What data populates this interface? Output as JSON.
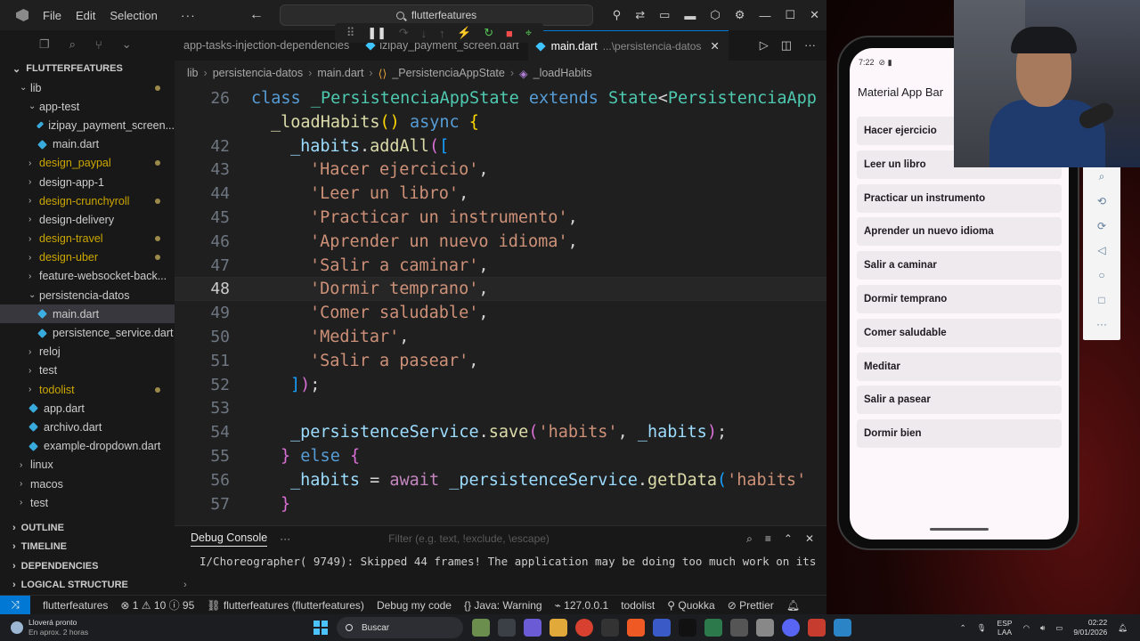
{
  "titlebar": {
    "menu": [
      "File",
      "Edit",
      "Selection"
    ],
    "more": "···",
    "search_text": "flutterfeatures"
  },
  "tabs": [
    {
      "label": "app-tasks-injection-dependencies",
      "active": false
    },
    {
      "label": "izipay_payment_screen.dart",
      "active": false
    },
    {
      "label": "main.dart",
      "path": "...\\persistencia-datos",
      "active": true
    }
  ],
  "breadcrumb": [
    "lib",
    "persistencia-datos",
    "main.dart",
    "_PersistenciaAppState",
    "_loadHabits"
  ],
  "explorer": {
    "root": "FLUTTERFEATURES",
    "items": [
      {
        "label": "lib",
        "indent": 1,
        "chev": "⌄",
        "dot": true
      },
      {
        "label": "app-test",
        "indent": 2,
        "chev": "⌄"
      },
      {
        "label": "izipay_payment_screen...",
        "indent": 3,
        "dart": true
      },
      {
        "label": "main.dart",
        "indent": 3,
        "dart": true
      },
      {
        "label": "design_paypal",
        "indent": 2,
        "chev": "›",
        "yellow": true,
        "dot": true
      },
      {
        "label": "design-app-1",
        "indent": 2,
        "chev": "›"
      },
      {
        "label": "design-crunchyroll",
        "indent": 2,
        "chev": "›",
        "yellow": true,
        "dot": true
      },
      {
        "label": "design-delivery",
        "indent": 2,
        "chev": "›"
      },
      {
        "label": "design-travel",
        "indent": 2,
        "chev": "›",
        "yellow": true,
        "dot": true
      },
      {
        "label": "design-uber",
        "indent": 2,
        "chev": "›",
        "yellow": true,
        "dot": true
      },
      {
        "label": "feature-websocket-back...",
        "indent": 2,
        "chev": "›"
      },
      {
        "label": "persistencia-datos",
        "indent": 2,
        "chev": "⌄"
      },
      {
        "label": "main.dart",
        "indent": 3,
        "dart": true,
        "selected": true
      },
      {
        "label": "persistence_service.dart",
        "indent": 3,
        "dart": true
      },
      {
        "label": "reloj",
        "indent": 2,
        "chev": "›"
      },
      {
        "label": "test",
        "indent": 2,
        "chev": "›"
      },
      {
        "label": "todolist",
        "indent": 2,
        "chev": "›",
        "yellow": true,
        "dot": true
      },
      {
        "label": "app.dart",
        "indent": 2,
        "dart": true
      },
      {
        "label": "archivo.dart",
        "indent": 2,
        "dart": true
      },
      {
        "label": "example-dropdown.dart",
        "indent": 2,
        "dart": true
      },
      {
        "label": "linux",
        "indent": 1,
        "chev": "›"
      },
      {
        "label": "macos",
        "indent": 1,
        "chev": "›"
      },
      {
        "label": "test",
        "indent": 1,
        "chev": "›"
      }
    ],
    "sections": [
      "OUTLINE",
      "TIMELINE",
      "DEPENDENCIES",
      "LOGICAL STRUCTURE"
    ]
  },
  "code_lines": [
    {
      "n": "26",
      "html": "<span class=\"kw\">class</span> <span class=\"cls\">_PersistenciaAppState</span> <span class=\"kw\">extends</span> <span class=\"cls\">State</span>&lt;<span class=\"cls\">PersistenciaApp</span>",
      "indent": 0
    },
    {
      "n": "",
      "html": "<span class=\"fn\">_loadHabits</span><span class=\"br1\">()</span> <span class=\"kw\">async</span> <span class=\"br1\">{</span>",
      "indent": 1
    },
    {
      "n": "42",
      "html": "<span class=\"var\">_habits</span>.<span class=\"fn\">addAll</span><span class=\"br2\">(</span><span class=\"br3\">[</span>",
      "indent": 2
    },
    {
      "n": "43",
      "html": "<span class=\"str\">'Hacer ejercicio'</span>,",
      "indent": 3
    },
    {
      "n": "44",
      "html": "<span class=\"str\">'Leer un libro'</span>,",
      "indent": 3
    },
    {
      "n": "45",
      "html": "<span class=\"str\">'Practicar un instrumento'</span>,",
      "indent": 3
    },
    {
      "n": "46",
      "html": "<span class=\"str\">'Aprender un nuevo idioma'</span>,",
      "indent": 3
    },
    {
      "n": "47",
      "html": "<span class=\"str\">'Salir a caminar'</span>,",
      "indent": 3
    },
    {
      "n": "48",
      "html": "<span class=\"str\">'Dormir temprano'</span>,",
      "indent": 3,
      "current": true
    },
    {
      "n": "49",
      "html": "<span class=\"str\">'Comer saludable'</span>,",
      "indent": 3
    },
    {
      "n": "50",
      "html": "<span class=\"str\">'Meditar'</span>,",
      "indent": 3
    },
    {
      "n": "51",
      "html": "<span class=\"str\">'Salir a pasear'</span>,",
      "indent": 3
    },
    {
      "n": "52",
      "html": "<span class=\"br3\">]</span><span class=\"br2\">)</span>;",
      "indent": 2
    },
    {
      "n": "53",
      "html": "",
      "indent": 0
    },
    {
      "n": "54",
      "html": "<span class=\"var\">_persistenceService</span>.<span class=\"fn\">save</span><span class=\"br2\">(</span><span class=\"str\">'habits'</span>, <span class=\"var\">_habits</span><span class=\"br2\">)</span>;",
      "indent": 2
    },
    {
      "n": "55",
      "html": "<span class=\"br2\">}</span> <span class=\"kw\">else</span> <span class=\"br2\">{</span>",
      "indent": 1.5
    },
    {
      "n": "56",
      "html": "<span class=\"var\">_habits</span> = <span class=\"aw\">await</span> <span class=\"var\">_persistenceService</span>.<span class=\"fn\">getData</span><span class=\"br3\">(</span><span class=\"str\">'habits'</span>",
      "indent": 2
    },
    {
      "n": "57",
      "html": "<span class=\"br2\">}</span>",
      "indent": 1.5
    }
  ],
  "panel": {
    "title": "Debug Console",
    "filter_placeholder": "Filter (e.g. text, !exclude, \\escape)",
    "log": "I/Choreographer( 9749): Skipped 44 frames!  The application may be doing too much work on its"
  },
  "statusbar": {
    "project": "flutterfeatures",
    "errors": "1",
    "warnings": "10",
    "infos": "95",
    "target": "flutterfeatures (flutterfeatures)",
    "debug_mode": "Debug my code",
    "java": "Java: Warning",
    "host": "127.0.0.1",
    "todolist": "todolist",
    "quokka": "Quokka",
    "prettier": "Prettier"
  },
  "phone": {
    "time": "7:22",
    "app_title": "Material App Bar",
    "habits": [
      "Hacer ejercicio",
      "Leer un libro",
      "Practicar un instrumento",
      "Aprender un nuevo idioma",
      "Salir a caminar",
      "Dormir temprano",
      "Comer saludable",
      "Meditar",
      "Salir a pasear",
      "Dormir bien"
    ]
  },
  "taskbar": {
    "weather_title": "Lloverá pronto",
    "weather_sub": "En aprox. 2 horas",
    "search": "Buscar",
    "lang1": "ESP",
    "lang2": "LAA",
    "time": "02:22",
    "date": "9/01/2026"
  },
  "colors": {
    "accent": "#0078d4",
    "editor_bg": "#1f1f1f",
    "sidebar_bg": "#181818",
    "string": "#ce9178",
    "keyword": "#569cd6"
  }
}
